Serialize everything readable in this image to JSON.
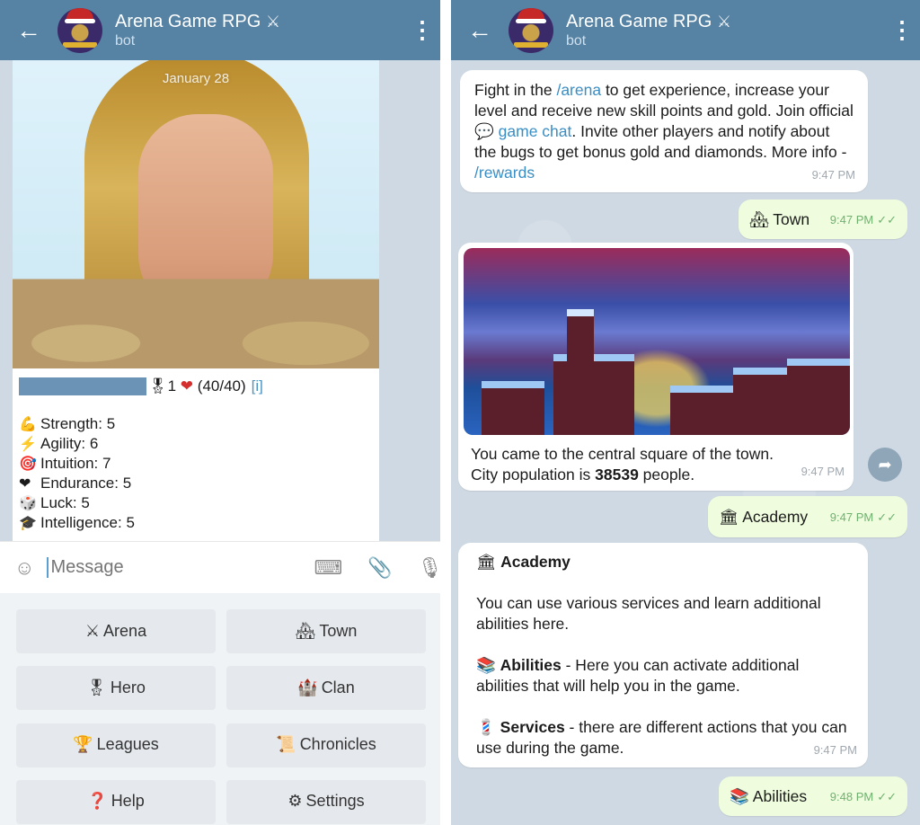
{
  "header": {
    "back_icon": "←",
    "title": "Arena Game RPG",
    "title_emoji": "⚔",
    "subtitle": "bot",
    "menu_icon": "⋮"
  },
  "left": {
    "date_chip": "January 28",
    "profile": {
      "level_emoji": "🎖",
      "level": "1",
      "heart_emoji": "❤",
      "hp": "(40/40)",
      "info_link": "[i]"
    },
    "stats": [
      {
        "emoji": "💪",
        "label": "Strength:",
        "value": "5"
      },
      {
        "emoji": "⚡",
        "label": "Agility:",
        "value": "6"
      },
      {
        "emoji": "🎯",
        "label": "Intuition:",
        "value": "7"
      },
      {
        "emoji": "❤",
        "label": "Endurance:",
        "value": "5"
      },
      {
        "emoji": "🎲",
        "label": "Luck:",
        "value": "5"
      },
      {
        "emoji": "🎓",
        "label": "Intelligence:",
        "value": "5"
      }
    ],
    "composer": {
      "sticker_icon": "☺",
      "placeholder": "Message",
      "keyboard_icon": "⌨",
      "attach_icon": "📎",
      "mic_icon": "🎙"
    },
    "keyboard": [
      {
        "emoji": "⚔",
        "label": "Arena"
      },
      {
        "emoji": "🏘",
        "label": "Town"
      },
      {
        "emoji": "🎖",
        "label": "Hero"
      },
      {
        "emoji": "🏰",
        "label": "Clan"
      },
      {
        "emoji": "🏆",
        "label": "Leagues"
      },
      {
        "emoji": "📜",
        "label": "Chronicles"
      },
      {
        "emoji": "❓",
        "label": "Help"
      },
      {
        "emoji": "⚙",
        "label": "Settings"
      }
    ]
  },
  "right": {
    "msg1": {
      "p1": "Fight in the ",
      "link1": "/arena",
      "p2": " to get experience, increase your level and receive new skill points and gold. Join official ",
      "chat_emoji": "💬",
      "link2": "game chat",
      "p3": ". Invite other players and notify about the bugs to get bonus gold and diamonds. More info - ",
      "link3": "/rewards",
      "time": "9:47 PM"
    },
    "msg2": {
      "emoji": "🏘",
      "text": "Town",
      "time": "9:47 PM",
      "checks": "✓✓"
    },
    "msg3": {
      "line1": "You came to the central square of the town.",
      "line2a": "City population is ",
      "population": "38539",
      "line2b": " people.",
      "time": "9:47 PM",
      "forward_icon": "➦"
    },
    "msg4": {
      "emoji": "🏛",
      "text": "Academy",
      "time": "9:47 PM",
      "checks": "✓✓"
    },
    "msg5": {
      "title_emoji": "🏛",
      "title": "Academy",
      "intro": "You can use various services and learn additional abilities here.",
      "abilities_emoji": "📚",
      "abilities_label": "Abilities",
      "abilities_text": " - Here you can activate additional abilities that will help you in the game.",
      "services_emoji": "💈",
      "services_label": "Services",
      "services_text": " - there are different actions that you can use during the game.",
      "time": "9:47 PM"
    },
    "msg6": {
      "emoji": "📚",
      "text": "Abilities",
      "time": "9:48 PM",
      "checks": "✓✓"
    }
  }
}
